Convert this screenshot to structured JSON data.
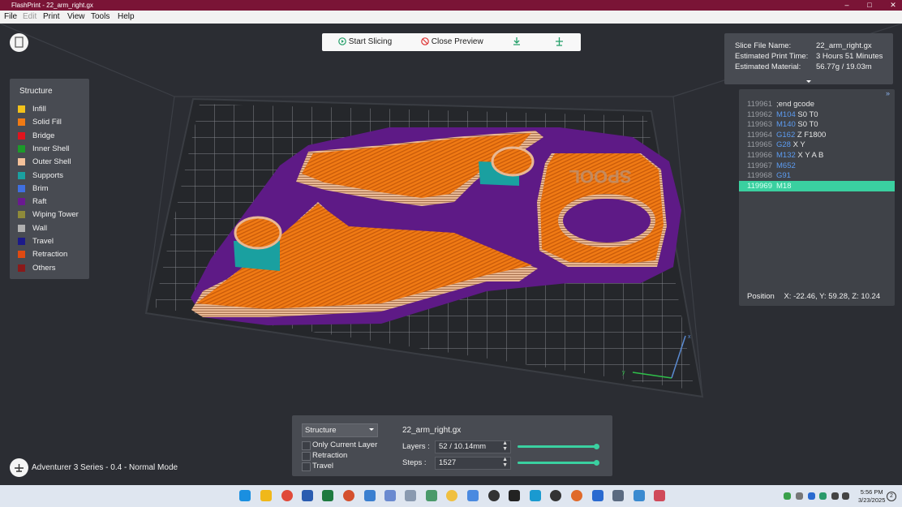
{
  "window": {
    "title": "FlashPrint - 22_arm_right.gx",
    "minimize": "–",
    "maximize": "□",
    "close": "✕"
  },
  "menu": [
    "File",
    "Edit",
    "Print",
    "View",
    "Tools",
    "Help"
  ],
  "toolbar": {
    "start_slicing": "Start Slicing",
    "close_preview": "Close Preview",
    "icons": [
      "play-icon",
      "no-entry-icon",
      "download-icon",
      "print-upload-icon"
    ]
  },
  "legend": {
    "title": "Structure",
    "items": [
      {
        "label": "Infill",
        "color": "#f2c21b"
      },
      {
        "label": "Solid Fill",
        "color": "#f07a14"
      },
      {
        "label": "Bridge",
        "color": "#e0141e"
      },
      {
        "label": "Inner Shell",
        "color": "#1c9a2a"
      },
      {
        "label": "Outer Shell",
        "color": "#f3c19a"
      },
      {
        "label": "Supports",
        "color": "#1aa0a0"
      },
      {
        "label": "Brim",
        "color": "#3f6fe0"
      },
      {
        "label": "Raft",
        "color": "#6a1a90"
      },
      {
        "label": "Wiping Tower",
        "color": "#8e8a3a"
      },
      {
        "label": "Wall",
        "color": "#b0b0b0"
      },
      {
        "label": "Travel",
        "color": "#1c1a8a"
      },
      {
        "label": "Retraction",
        "color": "#e04a12"
      },
      {
        "label": "Others",
        "color": "#8a1a1a"
      }
    ]
  },
  "slice_info": {
    "rows": [
      {
        "key": "Slice File Name:",
        "value": "22_arm_right.gx"
      },
      {
        "key": "Estimated Print Time:",
        "value": "3 Hours 51 Minutes"
      },
      {
        "key": "Estimated Material:",
        "value": "56.77g / 19.03m"
      }
    ]
  },
  "gcode": {
    "collapse": "»",
    "lines": [
      {
        "num": "119961",
        "cmd": "",
        "args": ";end gcode"
      },
      {
        "num": "119962",
        "cmd": "M104",
        "args": " S0 T0"
      },
      {
        "num": "119963",
        "cmd": "M140",
        "args": " S0 T0"
      },
      {
        "num": "119964",
        "cmd": "G162",
        "args": " Z F1800"
      },
      {
        "num": "119965",
        "cmd": "G28",
        "args": " X Y"
      },
      {
        "num": "119966",
        "cmd": "M132",
        "args": " X Y A B"
      },
      {
        "num": "119967",
        "cmd": "M652",
        "args": ""
      },
      {
        "num": "119968",
        "cmd": "G91",
        "args": ""
      },
      {
        "num": "119969",
        "cmd": "M18",
        "args": ""
      }
    ],
    "selected_index": 8,
    "position_label": "Position",
    "position_value": "X: -22.46, Y: 59.28, Z: 10.24"
  },
  "bottom": {
    "view_mode": "Structure",
    "checkboxes": [
      {
        "label": "Only Current Layer",
        "checked": false
      },
      {
        "label": "Retraction",
        "checked": false
      },
      {
        "label": "Travel",
        "checked": false
      }
    ],
    "file_name": "22_arm_right.gx",
    "layers_label": "Layers :",
    "layers_value": "52 / 10.14mm",
    "steps_label": "Steps :",
    "steps_value": "1527",
    "layers_slider": 1.0,
    "steps_slider": 1.0
  },
  "model_text": "SPOOL",
  "printer_label": "Adventurer 3 Series - 0.4 - Normal Mode",
  "taskbar": {
    "time": "5:56 PM",
    "date": "3/23/2025",
    "notifications": "2"
  }
}
